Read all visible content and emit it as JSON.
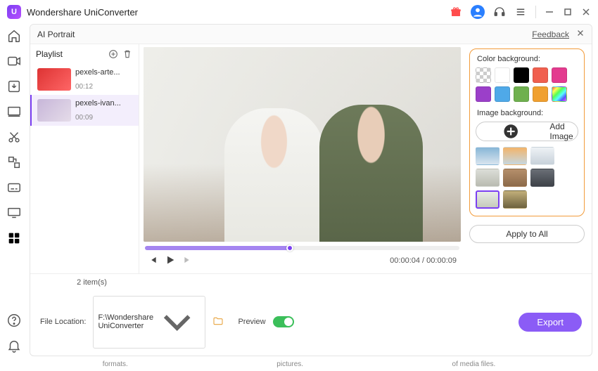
{
  "app": {
    "title": "Wondershare UniConverter"
  },
  "titlebar_icons": {
    "gift": "gift-icon",
    "user": "user-icon",
    "support": "headset-icon",
    "menu": "menu-icon"
  },
  "main_header": {
    "title": "AI Portrait",
    "feedback": "Feedback"
  },
  "playlist": {
    "title": "Playlist",
    "items": [
      {
        "name": "pexels-arte...",
        "duration": "00:12"
      },
      {
        "name": "pexels-ivan...",
        "duration": "00:09"
      }
    ],
    "count_label": "2 item(s)"
  },
  "player": {
    "time_current": "00:00:04",
    "time_total": "00:00:09"
  },
  "options": {
    "color_label": "Color background:",
    "colors": [
      {
        "name": "transparent",
        "css": "trans",
        "hex": ""
      },
      {
        "name": "white",
        "hex": "#ffffff"
      },
      {
        "name": "black",
        "hex": "#000000"
      },
      {
        "name": "coral",
        "hex": "#f0604f"
      },
      {
        "name": "magenta",
        "hex": "#e33b8f"
      },
      {
        "name": "purple",
        "hex": "#9b3fc9"
      },
      {
        "name": "sky",
        "hex": "#4fa9e8"
      },
      {
        "name": "green",
        "hex": "#6fb04f"
      },
      {
        "name": "orange",
        "hex": "#f0a030"
      },
      {
        "name": "rainbow",
        "hex": "linear-gradient(135deg,#f55,#ff5,#5f5,#5ff,#55f,#f5f)"
      }
    ],
    "image_label": "Image background:",
    "add_image_label": "Add Image",
    "apply_all_label": "Apply to All"
  },
  "footer": {
    "file_location_label": "File Location:",
    "file_location_path": "F:\\Wondershare UniConverter",
    "preview_label": "Preview",
    "preview_on": true,
    "export_label": "Export"
  },
  "truncated": {
    "a": "formats.",
    "b": "pictures.",
    "c": "of media files."
  }
}
